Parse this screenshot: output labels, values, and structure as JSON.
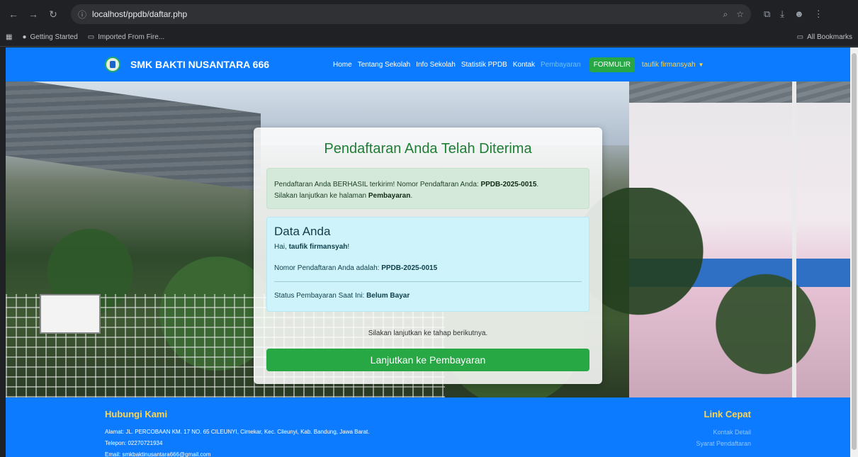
{
  "browser": {
    "url": "localhost/ppdb/daftar.php",
    "bookmarks": [
      "Getting Started",
      "Imported From Fire..."
    ],
    "all_bookmarks": "All Bookmarks"
  },
  "navbar": {
    "brand": "SMK BAKTI NUSANTARA 666",
    "links": [
      "Home",
      "Tentang Sekolah",
      "Info Sekolah",
      "Statistik PPDB",
      "Kontak",
      "Pembayaran"
    ],
    "active_link": "Pembayaran",
    "formulir": "FORMULIR",
    "user": "taufik firmansyah"
  },
  "card": {
    "title": "Pendaftaran Anda Telah Diterima",
    "alert": {
      "text1": "Pendaftaran Anda BERHASIL terkirim! Nomor Pendaftaran Anda: ",
      "reg_no": "PPDB-2025-0015",
      "text2": "Silakan lanjutkan ke halaman ",
      "page": "Pembayaran"
    },
    "data": {
      "heading": "Data Anda",
      "greeting_prefix": "Hai, ",
      "name": "taufik firmansyah",
      "greeting_suffix": "!",
      "reg_label": "Nomor Pendaftaran Anda adalah: ",
      "reg_no": "PPDB-2025-0015",
      "status_label": "Status Pembayaran Saat Ini: ",
      "status": "Belum Bayar"
    },
    "next_text": "Silakan lanjutkan ke tahap berikutnya.",
    "next_button": "Lanjutkan ke Pembayaran"
  },
  "footer": {
    "contact_title": "Hubungi Kami",
    "address": "Alamat: JL. PERCOBAAN KM. 17 NO. 65 CILEUNYI, Cimekar, Kec. Cileunyi, Kab. Bandung, Jawa Barat.",
    "phone": "Telepon: 02270721934",
    "email": "Email: smkbaktinusantara666@gmail.com",
    "links_title": "Link Cepat",
    "links": [
      "Kontak Detail",
      "Syarat Pendaftaran"
    ]
  }
}
